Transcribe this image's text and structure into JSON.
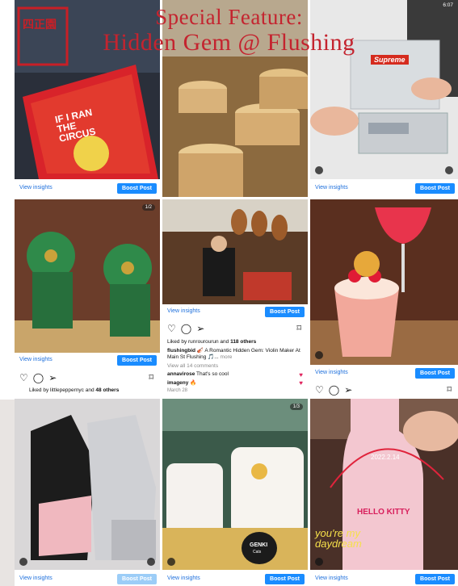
{
  "title": {
    "line1": "Special Feature:",
    "line2": "Hidden Gem @ Flushing"
  },
  "common": {
    "view_insights": "View insights",
    "boost_post": "Boost Post"
  },
  "tiles": {
    "book": {
      "book_text": "IF I RAN THE CIRCUS",
      "stamp_text": "四正園"
    },
    "phone": {
      "time": "6:07",
      "brand": "Supreme"
    },
    "lions": {
      "counter": "1/2"
    },
    "violin": {
      "liked_by": "Liked by runrourourun and",
      "likes": "118 others",
      "username": "flushingbid",
      "caption": "🎻 A Romantic Hidden Gem: Violin Maker At Main St Flushing 🎵...",
      "more": "more",
      "view_comments": "View all 14 comments",
      "comment1_user": "annavirose",
      "comment1_text": "That's so cool",
      "comment2_user": "imageny",
      "comment2_text": "🔥",
      "date": "March 28"
    },
    "lions_feed": {
      "liked_by": "Liked by littlepeppernyc and",
      "likes": "48 others"
    },
    "cats": {
      "counter": "1/3",
      "box_brand": "GENKI",
      "box_sub": "Cats"
    },
    "sake": {
      "date_text": "2022.2.14",
      "bottle": "HELLO KITTY",
      "overlay": "you're my daydream"
    }
  },
  "colors": {
    "title": "#c4242f",
    "boost": "#1a8cff",
    "link": "#1d6fdc"
  }
}
